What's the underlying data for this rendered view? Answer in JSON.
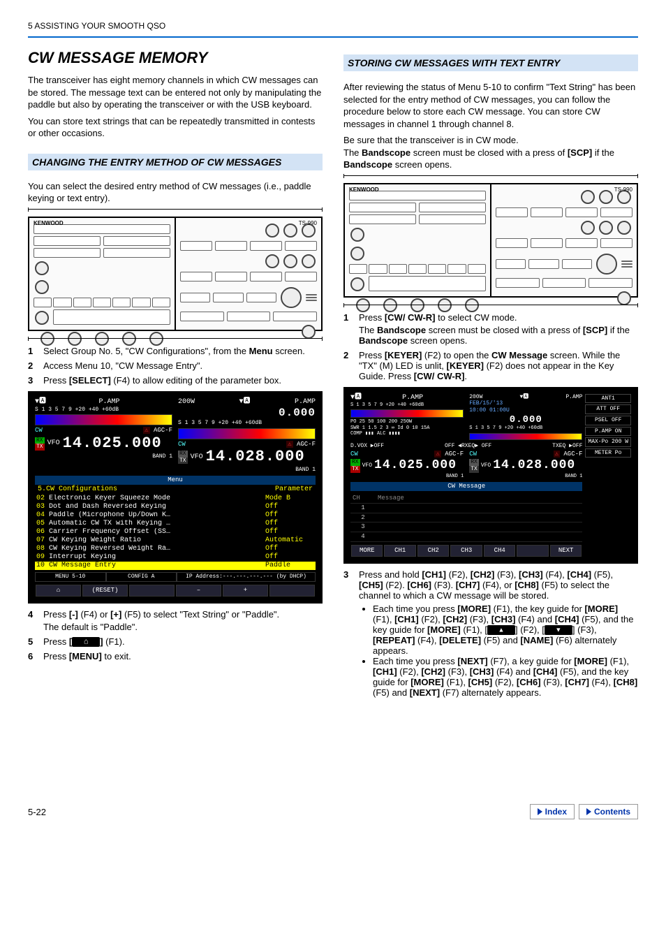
{
  "header": "5   ASSISTING YOUR SMOOTH QSO",
  "left": {
    "title": "CW MESSAGE MEMORY",
    "intro1": "The transceiver has eight memory channels in which CW messages can be stored. The message text can be entered not only by manipulating the paddle but also by operating the transceiver or with the USB keyboard.",
    "intro2": "You can store text strings that can be repeatedly transmitted in contests or other occasions.",
    "subhead": "CHANGING THE ENTRY METHOD OF CW MESSAGES",
    "intro3": "You can select the desired entry method of CW messages (i.e., paddle keying or text entry).",
    "diagram_label_left": "KENWOOD",
    "diagram_label_right": "TS-990",
    "step1": "Select Group No. 5, \"CW Configurations\", from the ",
    "step1_b": "Menu",
    "step1_c": " screen.",
    "step2": "Access Menu 10, \"CW Message Entry\".",
    "step3a": "Press ",
    "step3b": "[SELECT]",
    "step3c": " (F4) to allow editing of the parameter box.",
    "screen1": {
      "pamp": "P.AMP",
      "watt": "200W",
      "freq_zero": "0.000",
      "cw": "CW",
      "agc": "AGC-F",
      "vfo": "VFO",
      "rx": "RX",
      "tx": "TX",
      "freq_main": "14.025.000",
      "freq_sub": "14.028.000",
      "band": "BAND 1",
      "menu_title": "Menu",
      "group": "5.CW Configurations",
      "param": "Parameter",
      "rows": [
        {
          "n": "02",
          "name": "Electronic Keyer Squeeze Mode",
          "val": "Mode B"
        },
        {
          "n": "03",
          "name": "Dot and Dash Reversed Keying",
          "val": "Off"
        },
        {
          "n": "04",
          "name": "Paddle (Microphone Up/Down K…",
          "val": "Off"
        },
        {
          "n": "05",
          "name": "Automatic CW TX with Keying …",
          "val": "Off"
        },
        {
          "n": "06",
          "name": "Carrier Frequency Offset (SS…",
          "val": "Off"
        },
        {
          "n": "07",
          "name": "CW Keying Weight Ratio",
          "val": "Automatic"
        },
        {
          "n": "08",
          "name": "CW Keying Reversed Weight Ra…",
          "val": "Off"
        },
        {
          "n": "09",
          "name": "Interrupt Keying",
          "val": "Off"
        },
        {
          "n": "10",
          "name": "CW Message Entry",
          "val": "Paddle"
        }
      ],
      "menu_id": "MENU 5-10",
      "config": "CONFIG A",
      "ip": "IP Address:---.---.---.--- (by DHCP)",
      "reset": "(RESET)",
      "minus": "–",
      "plus": "+"
    },
    "step4a": "Press ",
    "step4b": "[-]",
    "step4c": " (F4) or ",
    "step4d": "[+]",
    "step4e": " (F5) to select \"Text String\" or \"Paddle\".",
    "step4_note": "The default is \"Paddle\".",
    "step5a": "Press ",
    "step5b": "[",
    "step5c": "]",
    "step5d": " (F1).",
    "step6a": "Press ",
    "step6b": "[MENU]",
    "step6c": " to exit."
  },
  "right": {
    "subhead": "STORING CW MESSAGES WITH TEXT ENTRY",
    "intro1": "After reviewing the status of Menu 5-10 to confirm \"Text String\" has been selected for the entry method of CW messages, you can follow the procedure below to store each CW message. You can store CW messages in channel 1 through channel 8.",
    "intro2a": "Be sure that the transceiver is in CW mode.",
    "intro2b_a": "The ",
    "intro2b_b": "Bandscope",
    "intro2b_c": " screen must be closed with a press of ",
    "intro2b_d": "[SCP]",
    "intro2b_e": " if the ",
    "intro2b_f": "Bandscope",
    "intro2b_g": " screen opens.",
    "step1a": "Press ",
    "step1b": "[CW/ CW-R]",
    "step1c": " to select CW mode.",
    "step1_sub_a": "The ",
    "step1_sub_b": "Bandscope",
    "step1_sub_c": " screen must be closed with a press of ",
    "step1_sub_d": "[SCP]",
    "step1_sub_e": " if the ",
    "step1_sub_f": "Bandscope",
    "step1_sub_g": " screen opens.",
    "step2a": "Press ",
    "step2b": "[KEYER]",
    "step2c": " (F2) to open the ",
    "step2d": "CW Message",
    "step2e": " screen. While the \"TX\" (M) LED is unlit, ",
    "step2f": "[KEYER]",
    "step2g": " (F2) does not appear in the Key Guide. Press ",
    "step2h": "[CW/ CW-R]",
    "step2i": ".",
    "screen2": {
      "pamp": "P.AMP",
      "watt": "200W",
      "date": "FEB/15/'13",
      "time": "10:00 01:00U",
      "zero": "0.000",
      "dvox": "D.VOX ▶OFF",
      "rxeq": "OFF ◀RXEQ▶ OFF",
      "txeq": "TXEQ ▶OFF",
      "cw": "CW",
      "agc": "AGC-F",
      "rx": "RX",
      "tx": "TX",
      "vfo": "VFO",
      "freq_main": "14.025.000",
      "freq_sub": "14.028.000",
      "band": "BAND 1",
      "ant1": "ANT1",
      "att": "ATT OFF",
      "psel": "PSEL OFF",
      "pamp_on": "P.AMP ON",
      "maxpo": "MAX-Po 200 W",
      "meter": "METER Po",
      "msg_title": "CW Message",
      "ch": "CH",
      "msg": "Message",
      "chs": [
        "1",
        "2",
        "3",
        "4"
      ],
      "soft": [
        "MORE",
        "CH1",
        "CH2",
        "CH3",
        "CH4",
        "",
        "NEXT"
      ]
    },
    "step3a": "Press and hold ",
    "step3b": "[CH1]",
    "step3c": " (F2), ",
    "step3d": "[CH2]",
    "step3e": " (F3), ",
    "step3f": "[CH3]",
    "step3g": " (F4), ",
    "step3h": "[CH4]",
    "step3i": " (F5), ",
    "step3j": "[CH5]",
    "step3k": " (F2). ",
    "step3l": "[CH6]",
    "step3m": " (F3). ",
    "step3n": "[CH7]",
    "step3o": " (F4), or ",
    "step3p": "[CH8]",
    "step3q": " (F5) to select the channel to which a CW message will be stored.",
    "bullet1a": "Each time you press ",
    "bullet1b": "[MORE]",
    "bullet1c": " (F1), the key guide for ",
    "bullet1d": "[MORE]",
    "bullet1e": " (F1), ",
    "bullet1f": "[CH1]",
    "bullet1g": " (F2), ",
    "bullet1h": "[CH2]",
    "bullet1i": " (F3), ",
    "bullet1j": "[CH3]",
    "bullet1k": " (F4) and ",
    "bullet1l": "[CH4]",
    "bullet1m": " (F5), and the key guide for ",
    "bullet1n": "[MORE]",
    "bullet1o": " (F1), [",
    "bullet1p": "] (F2), [",
    "bullet1q": "] (F3), ",
    "bullet1r": "[REPEAT]",
    "bullet1s": " (F4), ",
    "bullet1t": "[DELETE]",
    "bullet1u": " (F5) and ",
    "bullet1v": "[NAME]",
    "bullet1w": " (F6) alternately appears.",
    "bullet2a": "Each time you press ",
    "bullet2b": "[NEXT]",
    "bullet2c": " (F7), a key guide for ",
    "bullet2d": "[MORE]",
    "bullet2e": " (F1), ",
    "bullet2f": "[CH1]",
    "bullet2g": " (F2), ",
    "bullet2h": "[CH2]",
    "bullet2i": " (F3), ",
    "bullet2j": "[CH3]",
    "bullet2k": " (F4) and ",
    "bullet2l": "[CH4]",
    "bullet2m": " (F5), and the key guide for ",
    "bullet2n": "[MORE]",
    "bullet2o": " (F1), ",
    "bullet2p": "[CH5]",
    "bullet2q": " (F2), ",
    "bullet2r": "[CH6]",
    "bullet2s": " (F3), ",
    "bullet2t": "[CH7]",
    "bullet2u": " (F4), ",
    "bullet2v": "[CH8]",
    "bullet2w": " (F5) and ",
    "bullet2x": "[NEXT]",
    "bullet2y": " (F7) alternately appears."
  },
  "footer": {
    "page": "5-22",
    "index": "Index",
    "contents": "Contents"
  }
}
